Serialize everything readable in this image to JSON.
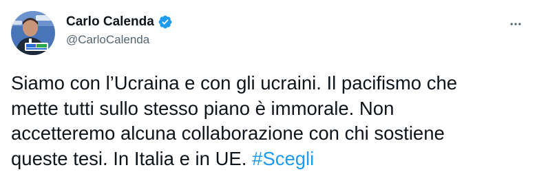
{
  "author": {
    "display_name": "Carlo Calenda",
    "handle": "@CarloCalenda",
    "verified": true,
    "avatar_icon": "profile-photo"
  },
  "menu": {
    "icon": "more-horizontal-icon"
  },
  "tweet": {
    "text": "Siamo con l’Ucraina e con gli ucraini. Il pacifismo che\nmette tutti sullo stesso piano è immorale. Non\naccetteremo alcuna collaborazione con chi sostiene\nqueste tesi. In Italia e in UE. ",
    "hashtag": "#Scegli"
  },
  "colors": {
    "accent": "#1d9bf0",
    "text": "#0f1419",
    "secondary": "#536471"
  }
}
